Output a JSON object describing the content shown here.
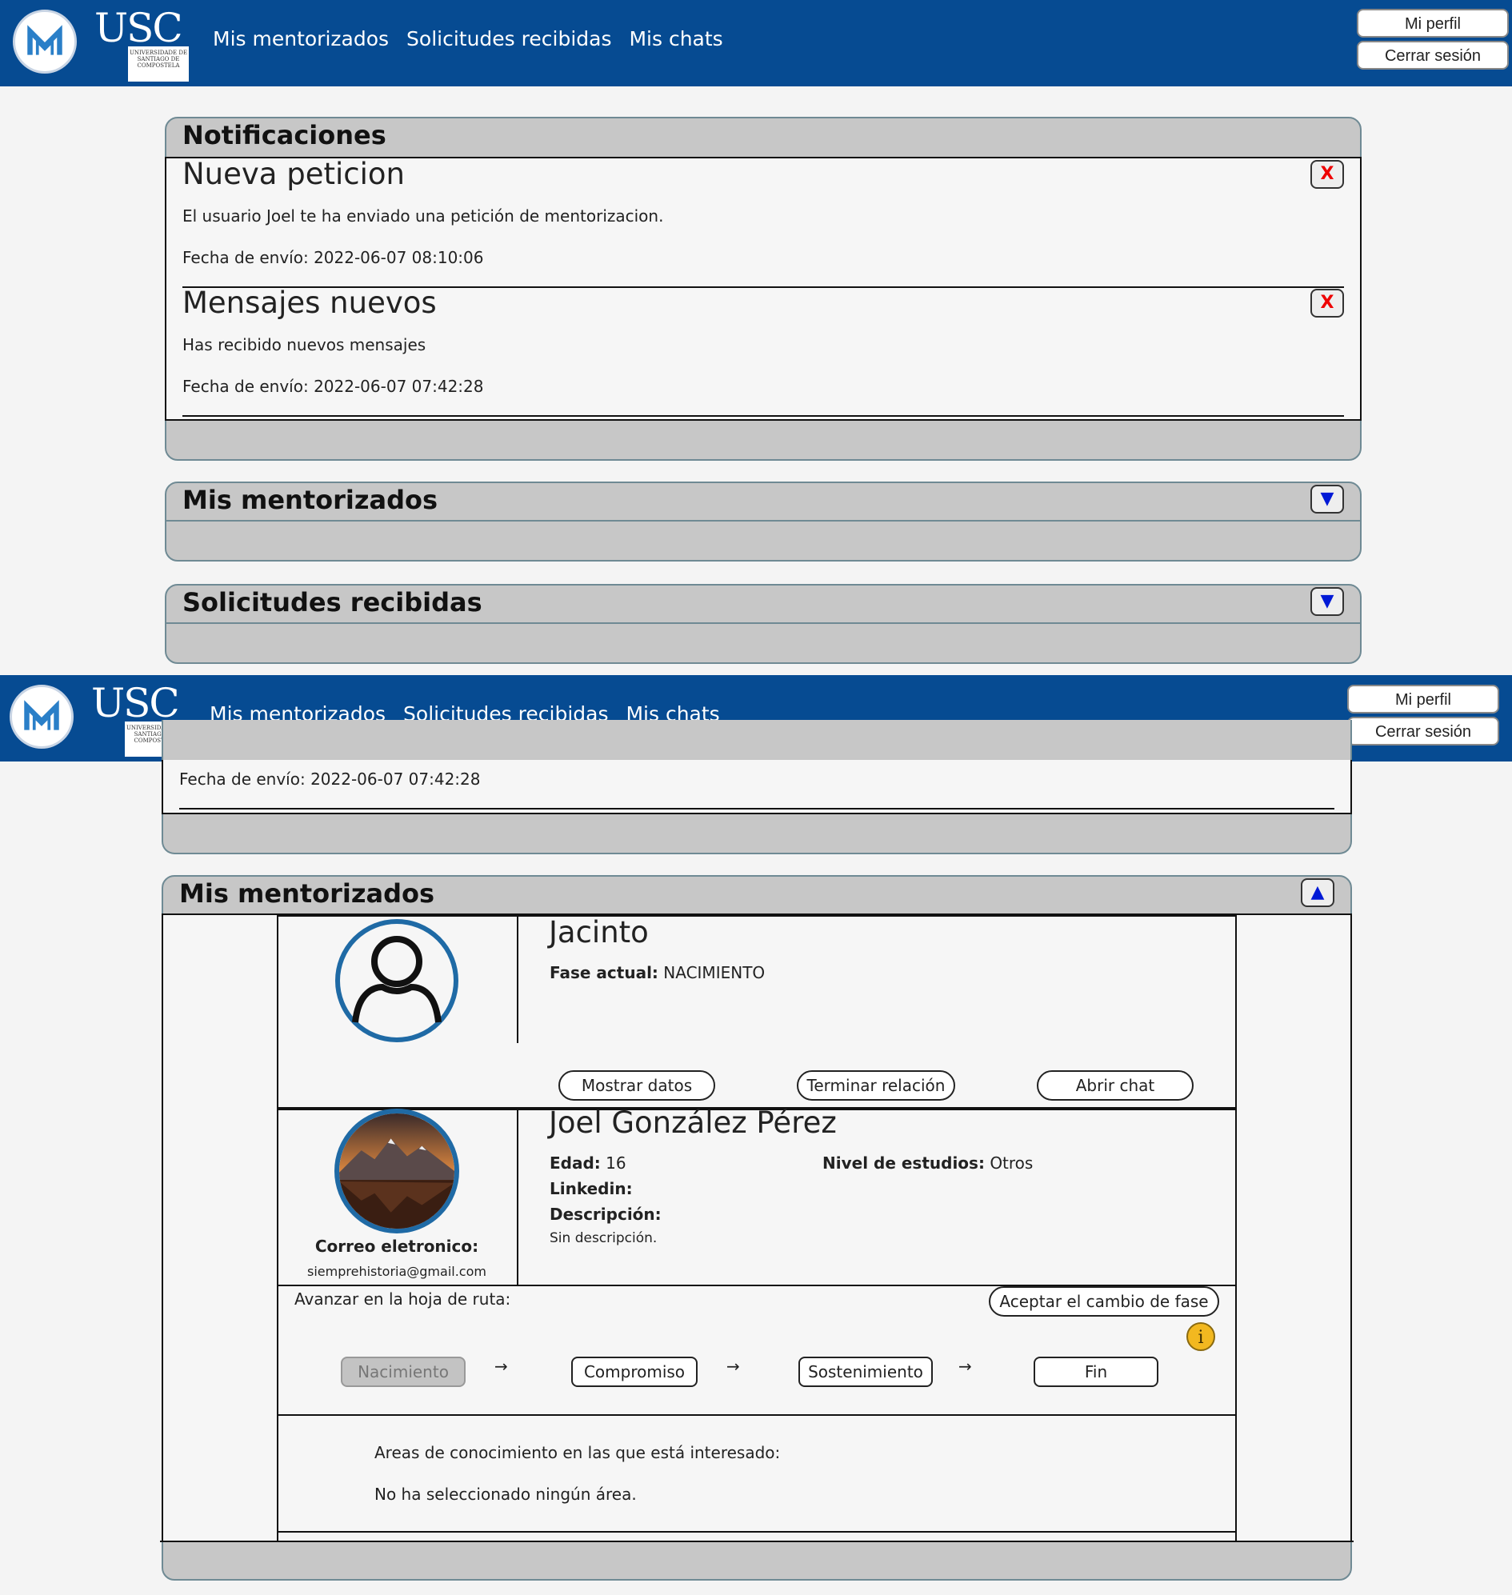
{
  "header": {
    "nav": [
      "Mis mentorizados",
      "Solicitudes recibidas",
      "Mis chats"
    ],
    "profile_button": "Mi perfil",
    "logout_button": "Cerrar sesión",
    "logo_text": "USC",
    "logo_sub": "UNIVERSIDADE DE SANTIAGO DE COMPOSTELA"
  },
  "notifications": {
    "title": "Notificaciones",
    "items": [
      {
        "title": "Nueva peticion",
        "text": "El usuario Joel te ha enviado una petición de mentorizacion.",
        "date": "Fecha de envío: 2022-06-07 08:10:06"
      },
      {
        "title": "Mensajes nuevos",
        "text": "Has recibido nuevos mensajes",
        "date": "Fecha de envío: 2022-06-07 07:42:28"
      }
    ],
    "close_symbol": "X"
  },
  "sections": {
    "mentees_title": "Mis mentorizados",
    "requests_title": "Solicitudes recibidas",
    "expand_symbol": "▼",
    "collapse_symbol": "▲"
  },
  "mentees": [
    {
      "name": "Jacinto",
      "phase_label": "Fase actual:",
      "phase_value": "NACIMIENTO",
      "buttons": [
        "Mostrar datos",
        "Terminar relación",
        "Abrir chat"
      ]
    },
    {
      "name": "Joel González Pérez",
      "age_label": "Edad:",
      "age_value": "16",
      "studies_label": "Nivel de estudios:",
      "studies_value": "Otros",
      "linkedin_label": "Linkedin:",
      "desc_label": "Descripción:",
      "desc_value": "Sin descripción.",
      "email_label": "Correo eletronico:",
      "email_value": "siemprehistoria@gmail.com",
      "roadmap_label": "Avanzar en la hoja de ruta:",
      "accept_button": "Aceptar el cambio de fase",
      "phases": [
        "Nacimiento",
        "Compromiso",
        "Sostenimiento",
        "Fin"
      ],
      "arrow": "→",
      "areas_label": "Areas de conocimiento en las que está interesado:",
      "areas_value": "No ha seleccionado ningún área."
    }
  ]
}
